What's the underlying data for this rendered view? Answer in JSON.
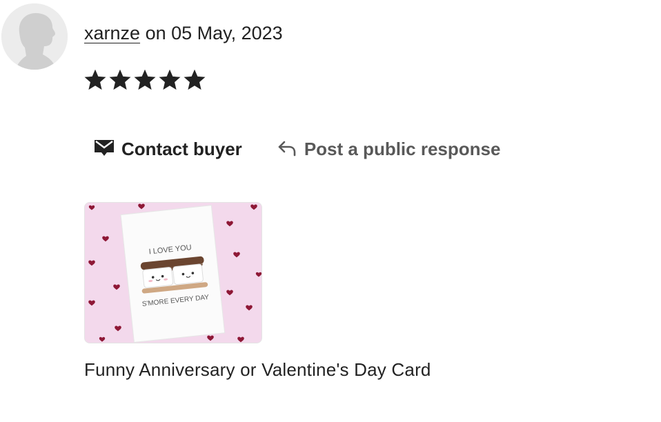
{
  "review": {
    "username": "xarnze",
    "date_text": "on 05 May, 2023",
    "rating": 5,
    "rating_max": 5
  },
  "actions": {
    "contact_label": "Contact buyer",
    "contact_icon": "envelope-icon",
    "respond_label": "Post a public response",
    "respond_icon": "reply-arrow-icon"
  },
  "item": {
    "card_line1": "I LOVE YOU",
    "card_line2": "S'MORE EVERY DAY",
    "title": "Funny Anniversary or Valentine's Day Card"
  },
  "colors": {
    "text": "#222222",
    "muted": "#595959",
    "thumb_background": "#f3d9ec",
    "heart": "#9b1c3a"
  }
}
